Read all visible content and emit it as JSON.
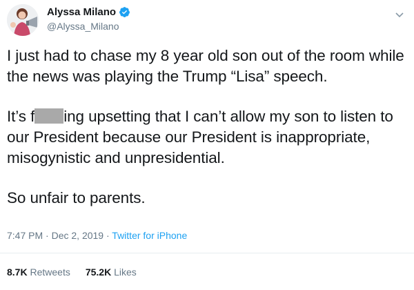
{
  "user": {
    "display_name": "Alyssa Milano",
    "handle": "@Alyssa_Milano"
  },
  "tweet": {
    "paragraph1": "I just had to chase my 8 year old son out of the room while the news was playing the Trump “Lisa” speech.",
    "paragraph2_prefix": "It’s f",
    "paragraph2_suffix": "ing upsetting that I can’t allow my son to listen to our President because our President is inappropriate, misogynistic and unpresidential.",
    "paragraph3": "So unfair to parents."
  },
  "meta": {
    "time": "7:47 PM",
    "sep1": " · ",
    "date": "Dec 2, 2019",
    "sep2": " · ",
    "source": "Twitter for iPhone"
  },
  "stats": {
    "retweets_count": "8.7K",
    "retweets_label": "Retweets",
    "likes_count": "75.2K",
    "likes_label": "Likes"
  },
  "colors": {
    "accent": "#1da1f2",
    "secondary_text": "#657786",
    "primary_text": "#14171a"
  },
  "icons": [
    "verified-badge-icon",
    "chevron-down-icon"
  ]
}
